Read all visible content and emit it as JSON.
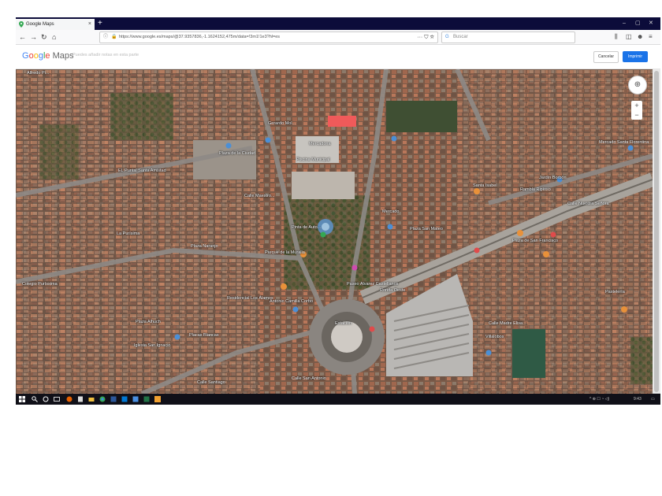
{
  "browser": {
    "tab_title": "Google Maps",
    "tab_close": "×",
    "new_tab": "+",
    "window_controls": [
      "–",
      "▢",
      "✕"
    ],
    "url": "https://www.google.es/maps/@37.9357836,-1.1624152,475m/data=!3m1!1e3?hl=es",
    "url_actions": "··· ⛉ ☆",
    "search_placeholder": "Buscar",
    "right_icons": [
      "⫼",
      "◫",
      "☻",
      "≡"
    ]
  },
  "maps_header": {
    "logo_text": "Google Maps",
    "search_hint": "Puedes añadir notas en esta parte",
    "cancel_label": "Cancelar",
    "print_label": "Imprimir"
  },
  "map": {
    "labels": [
      "Alfredo Pi...",
      "Gerardo Mol...",
      "EL Puntal Santa Amistad",
      "La Purísima",
      "Plaza de la Ciudad",
      "Piscina Municipal",
      "Mercadona",
      "Calle Maestro...",
      "Plaza Naranjo",
      "Parque de la Muralla",
      "Antonio Camilla Corbo",
      "Pinta de Auto...",
      "Paseo Alvarez Castellanos",
      "Residencial Los Álamos",
      "Plaza San Mateo",
      "Mercado",
      "Ronda Oeste",
      "Placas Blancas",
      "Rambla Ripioso",
      "Plaza Alhuch",
      "Iglesia San Ignacio",
      "Calle Santiago",
      "Villalobos",
      "Calle Madre Elisa",
      "Plaza de San Francisco",
      "Jardín Borbón",
      "Pastelería",
      "Calle Nuestra Señora",
      "Santa Isabel",
      "Calle San Antonio",
      "Colegio Puríssima",
      "Mercado Santa Florentina",
      "Estación"
    ]
  },
  "taskbar": {
    "tray_text": "^ ⊕ ☐ ◔ ◁)",
    "time": "9:43"
  },
  "colors": {
    "tabbar": "#0c0c3a",
    "accent_blue": "#1a73e8",
    "marker_red": "#f05a5a",
    "taskbar": "#101018"
  }
}
